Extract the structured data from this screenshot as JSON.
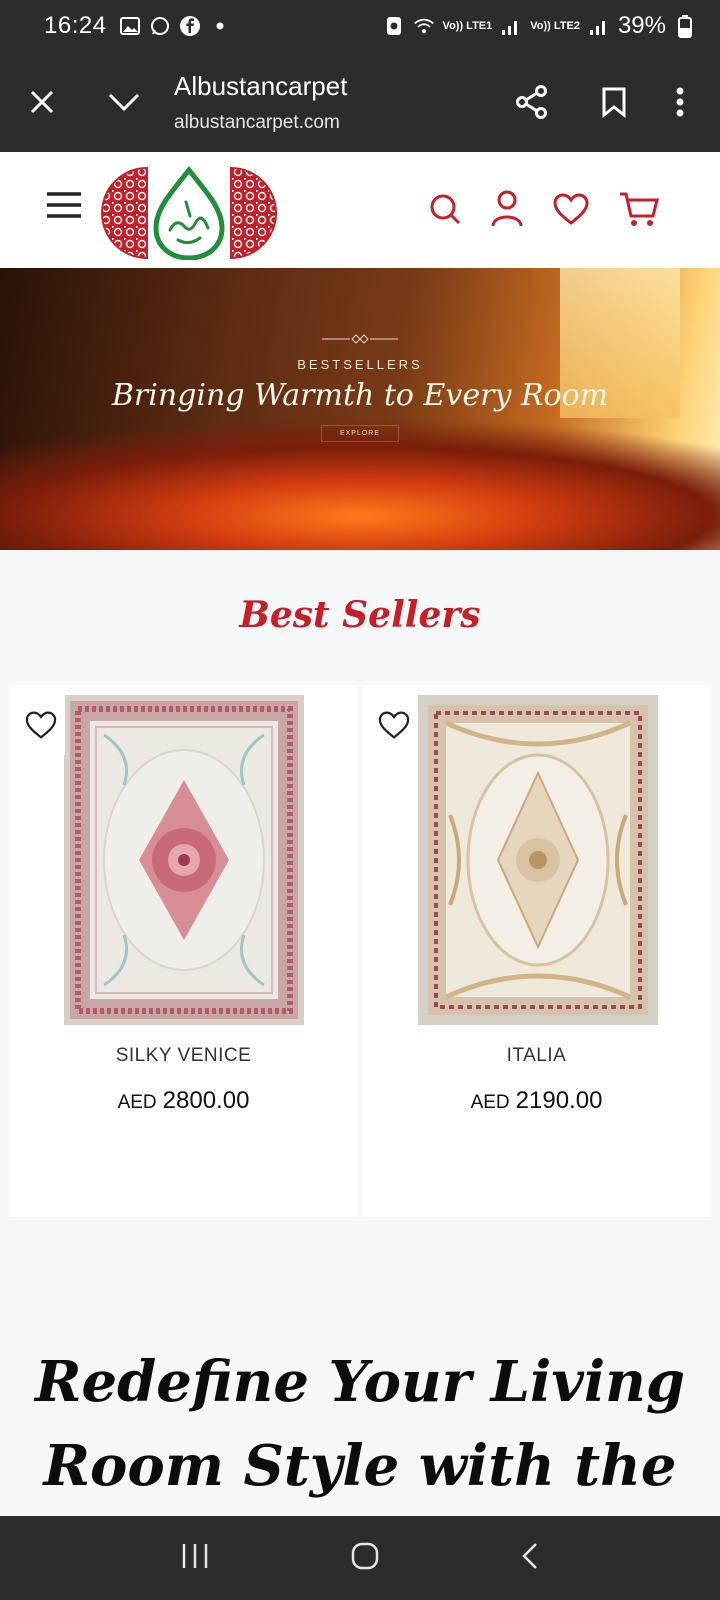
{
  "status_bar": {
    "time": "16:24",
    "sim1_label": "Vo)) LTE1",
    "sim2_label": "Vo)) LTE2",
    "battery": "39%"
  },
  "browser": {
    "title": "Albustancarpet",
    "url": "albustancarpet.com"
  },
  "hero": {
    "kicker": "BESTSELLERS",
    "title": "Bringing Warmth to Every Room",
    "button": "EXPLORE"
  },
  "best_sellers": {
    "title": "Best Sellers",
    "products": [
      {
        "name": "SILKY VENICE",
        "currency": "AED",
        "price": "2800.00"
      },
      {
        "name": "ITALIA",
        "currency": "AED",
        "price": "2190.00"
      }
    ]
  },
  "promo": {
    "line1": "Redefine Your Living",
    "line2": "Room Style with the"
  },
  "colors": {
    "brand_red": "#c61f27",
    "brand_green": "#1f8f3a",
    "bar_dark": "#2b2c2e"
  },
  "icons": {
    "header": [
      "menu-icon",
      "search-icon",
      "account-icon",
      "wishlist-icon",
      "cart-icon"
    ],
    "browser": [
      "close-icon",
      "chevron-down-icon",
      "share-icon",
      "bookmark-icon",
      "more-icon"
    ]
  }
}
